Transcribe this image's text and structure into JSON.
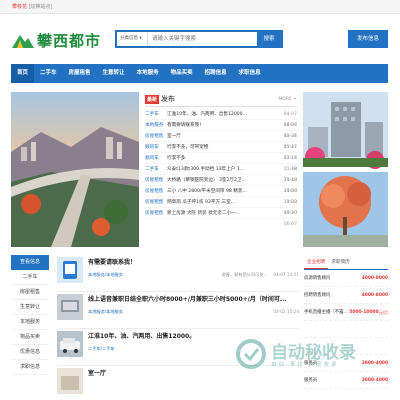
{
  "topbar": {
    "city": "攀枝花",
    "switch": "[切换站点]"
  },
  "header": {
    "logo_text": "攀西都市",
    "search_category": "分类信息",
    "search_placeholder": "请输入关键字搜索",
    "search_button": "搜索",
    "post_button": "发布信息"
  },
  "nav": [
    "首页",
    "二手车",
    "房屋租售",
    "生意转让",
    "本地服务",
    "物品买卖",
    "招聘信息",
    "求职信息"
  ],
  "news": {
    "badge": "最新",
    "title": "发布",
    "more": "MORE +",
    "rows": [
      {
        "cat": "二手车",
        "text": "江淮10年、油、汽两用、出售12000...",
        "date": "04-07 18:28"
      },
      {
        "cat": "本地服务",
        "text": "有需要请联系我！",
        "date": "04-07 19:31"
      },
      {
        "cat": "房屋租售",
        "text": "室一厅",
        "date": "02-26 15:41"
      },
      {
        "cat": "顺风车",
        "text": "行李不多，可带宠物",
        "date": "01-17 12:14"
      },
      {
        "cat": "顺风车",
        "text": "行李不多",
        "date": "01-17 11:39"
      },
      {
        "cat": "二手车",
        "text": "众泰t13款t300 手动挡 13年上户 1...",
        "date": "11-18 20:40"
      },
      {
        "cat": "房屋租售",
        "text": "大桥路（攀钢医院旁边）  3室2厅2卫...",
        "date": "11-18 20:08"
      },
      {
        "cat": "房屋租售",
        "text": "三小 八中 2800/平米空间带 98 精装...",
        "date": "11-20 10:03"
      },
      {
        "cat": "房屋租售",
        "text": "炳草岗 瓜子坪1栋 93平方 三室...",
        "date": "11-20 00:30"
      },
      {
        "cat": "房屋租售",
        "text": "新上房源 大院 新装 状元亲二小一...",
        "date": "11-20 06:07"
      }
    ]
  },
  "sidemenu": {
    "head": "查看信息",
    "items": [
      "二手车",
      "房屋租售",
      "生意转让",
      "本地服务",
      "物品买卖",
      "优惠信息",
      "求职信息"
    ]
  },
  "listings": [
    {
      "title": "有需要请联系我！",
      "cat": "本地服务/本地服务",
      "user": "游客，如有您公司可发...",
      "date": "04-07 14:21"
    },
    {
      "title": "线上语音兼职日结全职六小时8000+/月兼职三小时5000+/月（时间可...",
      "cat": "本地服务/本地服务",
      "user": "",
      "date": "04-02 15:24"
    },
    {
      "title": "江淮10年、油、汽两用、出售12000。",
      "cat": "二手车/二手车",
      "user": "",
      "date": ""
    },
    {
      "title": "室一厅",
      "cat": "",
      "user": "",
      "date": ""
    }
  ],
  "jobs": {
    "tabs": [
      "企业招聘",
      "求职简历"
    ],
    "items": [
      {
        "title": "房源销售顾问",
        "pay": "4000-8000",
        "sub": ""
      },
      {
        "title": "招聘销售顾问",
        "pay": "4000-8000",
        "sub": ""
      },
      {
        "title": "手机直播主播（不露...",
        "pay": "5000-10000",
        "sub": "元/月"
      },
      {
        "title": "",
        "pay": "",
        "sub": ""
      },
      {
        "title": "",
        "pay": "",
        "sub": ""
      },
      {
        "title": "服务员",
        "pay": "3000-4000",
        "sub": ""
      },
      {
        "title": "服务员",
        "pay": "3000-4000",
        "sub": ""
      }
    ]
  },
  "watermark": {
    "text": "自动秘收录",
    "sub": "自动·来访·自动收录"
  }
}
